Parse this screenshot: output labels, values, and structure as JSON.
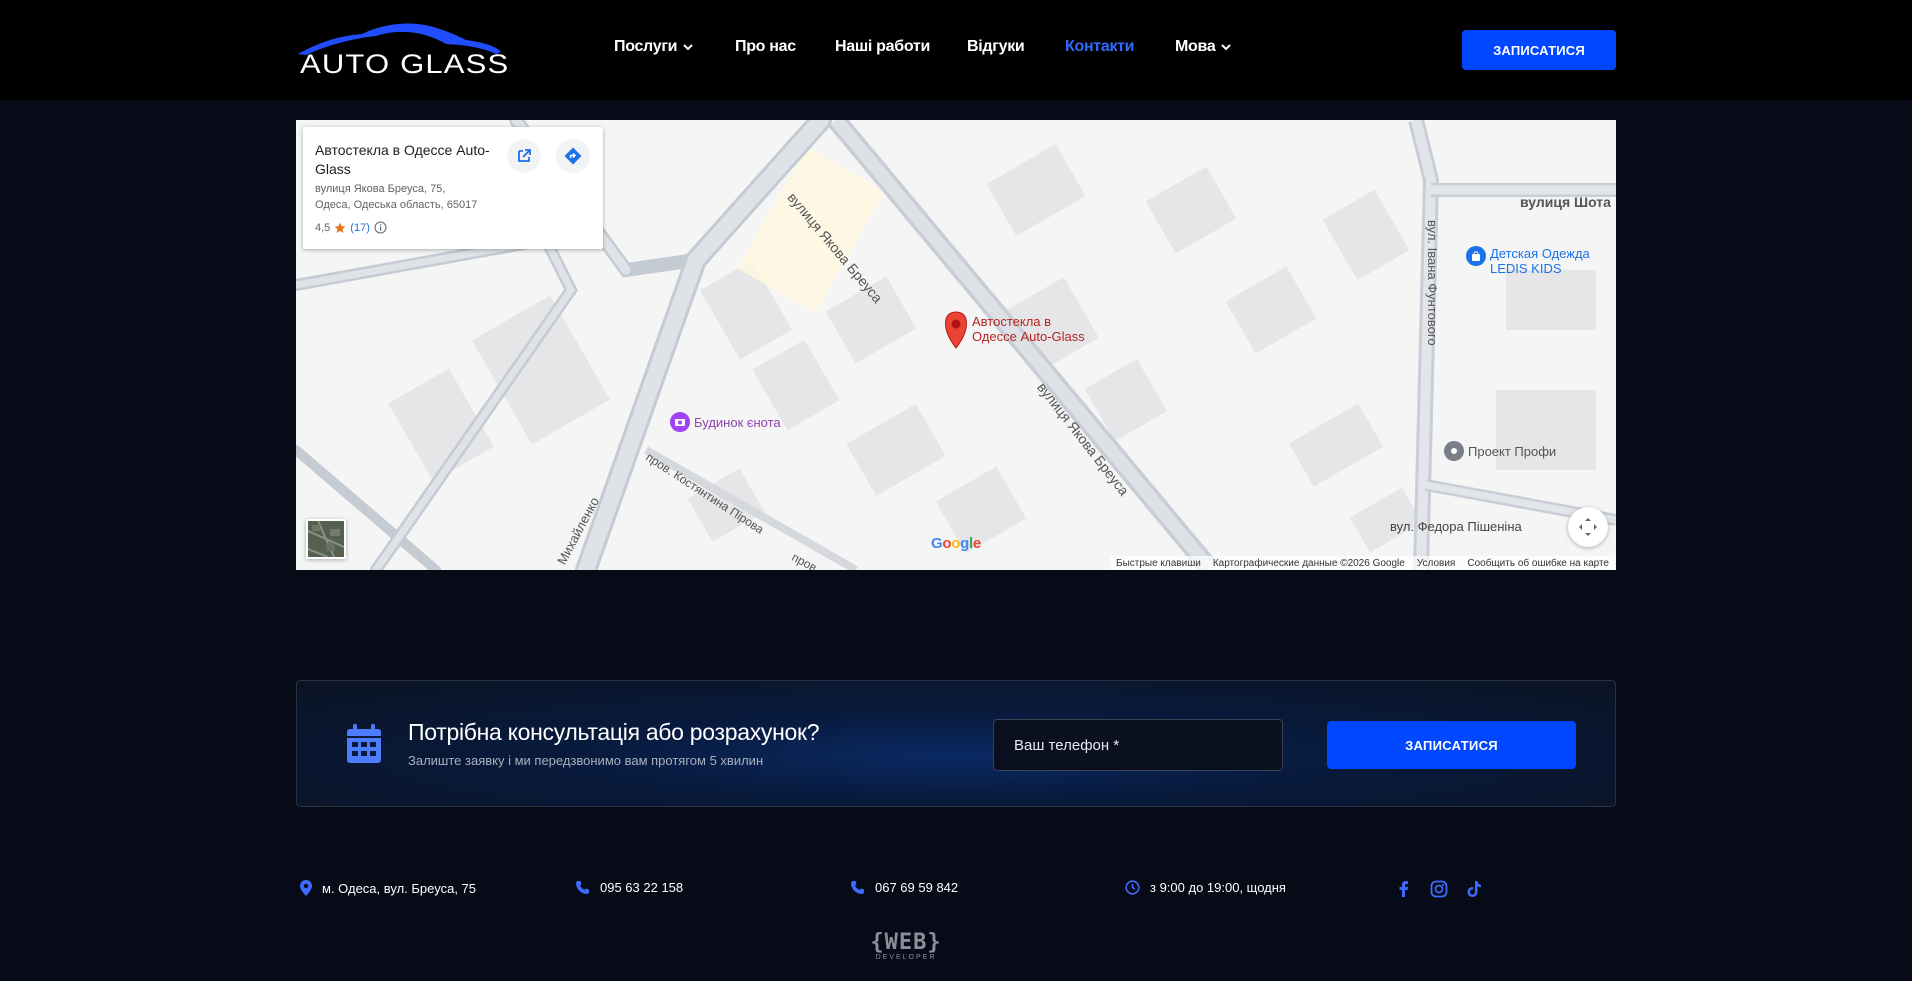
{
  "header": {
    "logo_text": "AUTO GLASS",
    "nav": [
      {
        "label": "Послуги",
        "has_dropdown": true,
        "active": false
      },
      {
        "label": "Про нас",
        "has_dropdown": false,
        "active": false
      },
      {
        "label": "Наші работи",
        "has_dropdown": false,
        "active": false
      },
      {
        "label": "Відгуки",
        "has_dropdown": false,
        "active": false
      },
      {
        "label": "Контакти",
        "has_dropdown": false,
        "active": true
      },
      {
        "label": "Мова",
        "has_dropdown": true,
        "active": false
      }
    ],
    "cta_label": "ЗАПИСАТИСЯ"
  },
  "map": {
    "card": {
      "title": "Автостекла в Одессе Auto-Glass",
      "address_line1": "вулиця Якова Бреуса, 75,",
      "address_line2": "Одеса, Одеська область, 65017",
      "rating": "4,5",
      "review_count": "(17)",
      "open_icon": "open-in-new-icon",
      "directions_icon": "directions-icon"
    },
    "pin_label_line1": "Автостекла в",
    "pin_label_line2": "Одессе Auto-Glass",
    "streets": {
      "breusa_top": "вулиця Якова Бреуса",
      "breusa_bottom": "вулиця Якова Бреуса",
      "shota": "вулиця Шота",
      "funtovoho": "вул. Івана Фунтового",
      "pishenyna": "вул. Федора Пішеніна",
      "pirova": "пров. Костянтина Пірова",
      "pirova_tail": "пров. пров.",
      "mykhailenko": "Михайленко"
    },
    "pois": {
      "enot": "Будинок єнота",
      "ledis_line1": "Детская Одежда",
      "ledis_line2": "LEDIS KIDS",
      "profi": "Проект Профи"
    },
    "google": "Google",
    "footer": [
      "Быстрые клавиши",
      "Картографические данные ©2026 Google",
      "Условия",
      "Сообщить об ошибке на карте"
    ],
    "colors": {
      "pin": "#ea4335",
      "poi_purple": "#a142f4",
      "poi_blue": "#1a73e8",
      "poi_gray": "#7a7f87"
    }
  },
  "consult": {
    "title": "Потрібна консультація або розрахунок?",
    "subtitle": "Залиште заявку і ми передзвонимо вам протягом 5 хвилин",
    "phone_placeholder": "Ваш телефон *",
    "button_label": "ЗАПИСАТИСЯ"
  },
  "footer": {
    "address": "м. Одеса, вул. Бреуса, 75",
    "phone1": "095 63 22 158",
    "phone2": "067 69 59 842",
    "hours": "з 9:00 до 19:00, щодня",
    "social": [
      "facebook-icon",
      "instagram-icon",
      "tiktok-icon"
    ],
    "dev_logo_big": "{WEB}",
    "dev_logo_small": "DEVELOPER"
  },
  "colors": {
    "accent": "#0047ff",
    "active_nav": "#2e6bff",
    "bg": "#060b17",
    "icon_blue": "#3d6bff"
  }
}
